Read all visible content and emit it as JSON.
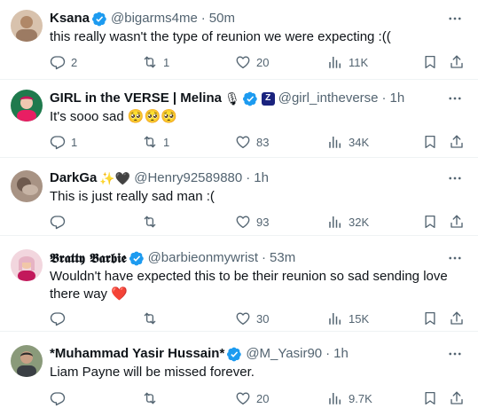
{
  "tweets": [
    {
      "name": "Ksana",
      "handle": "@bigarms4me",
      "time": "50m",
      "text": "this really wasn't the type of reunion we were expecting :((",
      "replies": "2",
      "retweets": "1",
      "likes": "20",
      "views": "11K",
      "avatar_color": "#c9a98a"
    },
    {
      "name": "GIRL in the VERSE | Melina",
      "name_emojis": "🎙",
      "handle": "@girl_intheverse",
      "time": "1h",
      "text": "It's sooo sad 🥺🥺🥺",
      "replies": "1",
      "retweets": "1",
      "likes": "83",
      "views": "34K",
      "avatar_color": "#2e8b57"
    },
    {
      "name": "DarkGa",
      "name_emojis": "✨🖤",
      "handle": "@Henry92589880",
      "time": "1h",
      "text": "This is just really sad man :(",
      "replies": "",
      "retweets": "",
      "likes": "93",
      "views": "32K",
      "avatar_color": "#8a7566"
    },
    {
      "name": "𝕭𝖗𝖆𝖙𝖙𝖞 𝕭𝖆𝖗𝖇𝖎𝖊",
      "handle": "@barbieonmywrist",
      "time": "53m",
      "text": "Wouldn't have expected this to be their reunion so sad sending love there way ❤️",
      "replies": "",
      "retweets": "",
      "likes": "30",
      "views": "15K",
      "avatar_color": "#d9a7b5"
    },
    {
      "name": "*Muhammad Yasir Hussain*",
      "handle": "@M_Yasir90",
      "time": "1h",
      "text": "Liam Payne will be missed forever.",
      "replies": "",
      "retweets": "",
      "likes": "20",
      "views": "9.7K",
      "avatar_color": "#6b7a5e"
    }
  ],
  "colors": {
    "verified": "#1d9bf0",
    "muted": "#536471",
    "text": "#0f1419",
    "divider": "#eff3f4"
  },
  "icons": [
    "more-icon",
    "verified-badge-icon",
    "reply-icon",
    "retweet-icon",
    "like-icon",
    "views-icon",
    "bookmark-icon",
    "share-icon",
    "microphone-emoji",
    "x-logo-icon"
  ]
}
